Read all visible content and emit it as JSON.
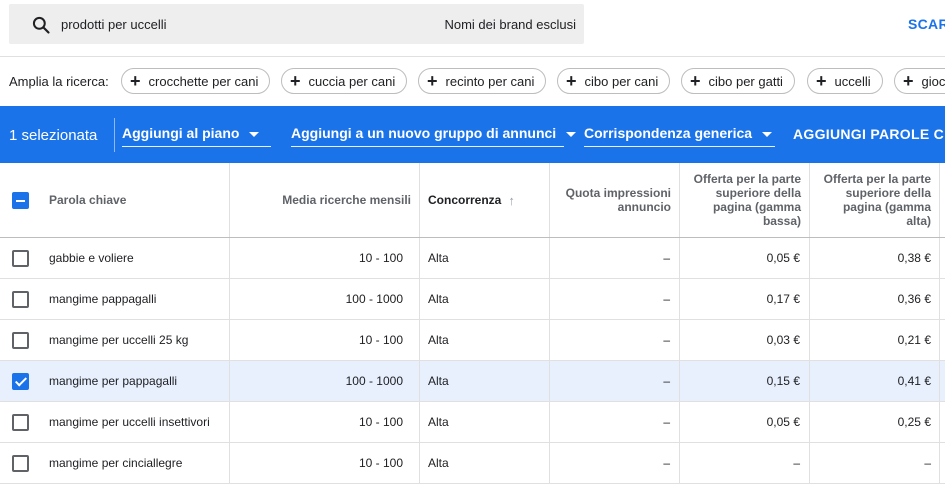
{
  "search": {
    "query": "prodotti per uccelli",
    "excluded_brands_label": "Nomi dei brand esclusi",
    "action_label": "SCAR"
  },
  "broaden": {
    "label": "Amplia la ricerca:",
    "chips": [
      "crocchette per cani",
      "cuccia per cani",
      "recinto per cani",
      "cibo per cani",
      "cibo per gatti",
      "uccelli",
      "gioc"
    ]
  },
  "action_bar": {
    "selected_count": "1 selezionata",
    "add_to_plan": "Aggiungi al piano",
    "add_to_new_group": "Aggiungi a un nuovo gruppo di annunci",
    "match_type": "Corrispondenza generica",
    "add_keywords": "AGGIUNGI PAROLE CHIA"
  },
  "table": {
    "headers": {
      "keyword": "Parola chiave",
      "avg_searches": "Media ricerche mensili",
      "competition": "Concorrenza",
      "impression_share": "Quota impressioni annuncio",
      "bid_low": "Offerta per la parte superiore della pagina (gamma bassa)",
      "bid_high": "Offerta per la parte superiore della pagina (gamma alta)"
    },
    "rows": [
      {
        "keyword": "gabbie e voliere",
        "searches": "10 - 100",
        "competition": "Alta",
        "share": "–",
        "low": "0,05 €",
        "high": "0,38 €",
        "checked": false
      },
      {
        "keyword": "mangime pappagalli",
        "searches": "100 - 1000",
        "competition": "Alta",
        "share": "–",
        "low": "0,17 €",
        "high": "0,36 €",
        "checked": false
      },
      {
        "keyword": "mangime per uccelli 25 kg",
        "searches": "10 - 100",
        "competition": "Alta",
        "share": "–",
        "low": "0,03 €",
        "high": "0,21 €",
        "checked": false
      },
      {
        "keyword": "mangime per pappagalli",
        "searches": "100 - 1000",
        "competition": "Alta",
        "share": "–",
        "low": "0,15 €",
        "high": "0,41 €",
        "checked": true
      },
      {
        "keyword": "mangime per uccelli insettivori",
        "searches": "10 - 100",
        "competition": "Alta",
        "share": "–",
        "low": "0,05 €",
        "high": "0,25 €",
        "checked": false
      },
      {
        "keyword": "mangime per cinciallegre",
        "searches": "10 - 100",
        "competition": "Alta",
        "share": "–",
        "low": "–",
        "high": "–",
        "checked": false
      }
    ]
  },
  "colors": {
    "accent": "#1a73e8",
    "selected_row": "#e8f0fe"
  }
}
